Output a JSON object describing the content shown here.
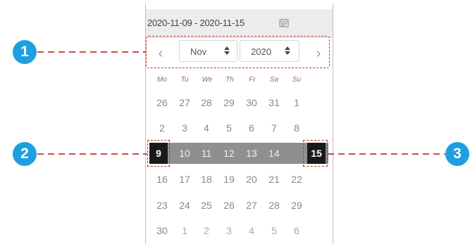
{
  "date_range": {
    "text": "2020-11-09 - 2020-11-15",
    "icon": "calendar-icon"
  },
  "navigation": {
    "prev_label": "‹",
    "next_label": "›",
    "month": {
      "value": "Nov",
      "icon": "up-down-arrows-icon"
    },
    "year": {
      "value": "2020",
      "icon": "up-down-arrows-icon"
    }
  },
  "weekdays": [
    "Mo",
    "Tu",
    "We",
    "Th",
    "Fr",
    "Sa",
    "Su"
  ],
  "weeks": [
    [
      "26",
      "27",
      "28",
      "29",
      "30",
      "31",
      "1"
    ],
    [
      "2",
      "3",
      "4",
      "5",
      "6",
      "7",
      "8"
    ],
    [
      "9",
      "10",
      "11",
      "12",
      "13",
      "14",
      "15"
    ],
    [
      "16",
      "17",
      "18",
      "19",
      "20",
      "21",
      "22"
    ],
    [
      "23",
      "24",
      "25",
      "26",
      "27",
      "28",
      "29"
    ],
    [
      "30",
      "1",
      "2",
      "3",
      "4",
      "5",
      "6"
    ]
  ],
  "selection": {
    "start": "9",
    "end": "15"
  },
  "callouts": [
    "1",
    "2",
    "3"
  ],
  "colors": {
    "callout": "#1e9fe0",
    "highlight_dash": "#c0392b",
    "range_fill": "#8f8f8f",
    "selected_end": "#1a1a1a"
  }
}
